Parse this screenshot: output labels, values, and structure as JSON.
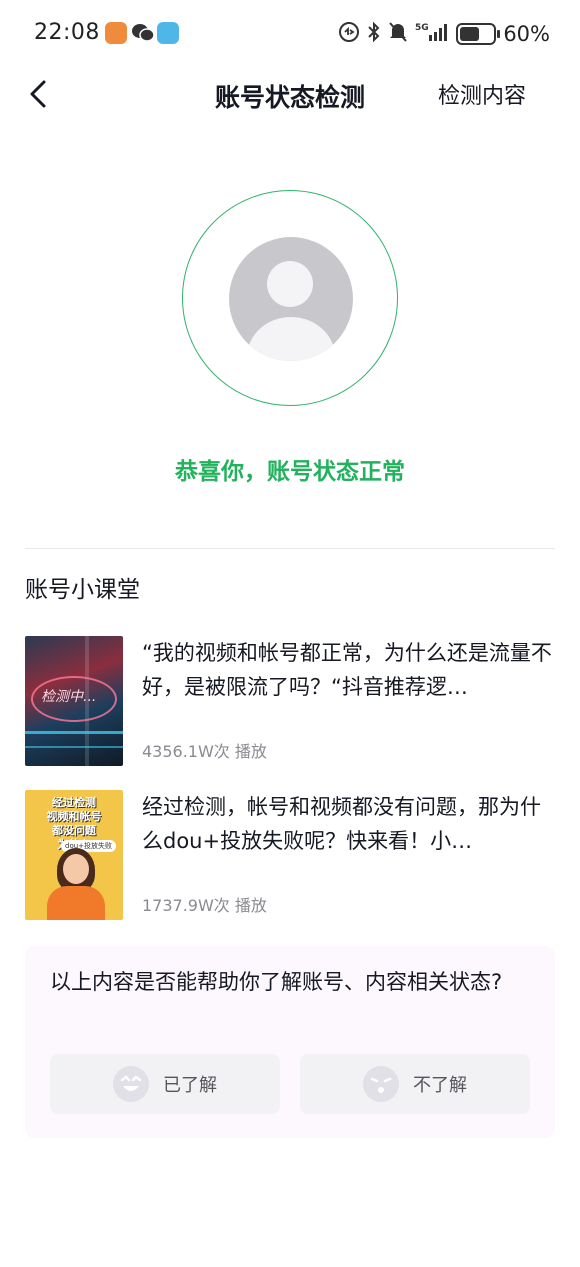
{
  "status_bar": {
    "time": "22:08",
    "network": "5G",
    "battery_text": "60%",
    "battery_level": 0.6
  },
  "nav": {
    "title": "账号状态检测",
    "action": "检测内容"
  },
  "result": {
    "message": "恭喜你，账号状态正常",
    "accent_color": "#22b25e"
  },
  "section": {
    "title": "账号小课堂"
  },
  "courses": [
    {
      "text": "“我的视频和帐号都正常，为什么还是流量不好，是被限流了吗？“抖音推荐逻…",
      "views": "4356.1W次 播放",
      "thumb_text": "检测中..."
    },
    {
      "text": "经过检测，帐号和视频都没有问题，那为什么dou+投放失败呢？快来看！小…",
      "views": "1737.9W次 播放",
      "thumb_text": "经过检测\n视频和帐号\n都没问题\n为什么",
      "thumb_tag": "dou+投放失败"
    }
  ],
  "feedback": {
    "question": "以上内容是否能帮助你了解账号、内容相关状态?",
    "yes_label": "已了解",
    "no_label": "不了解"
  }
}
